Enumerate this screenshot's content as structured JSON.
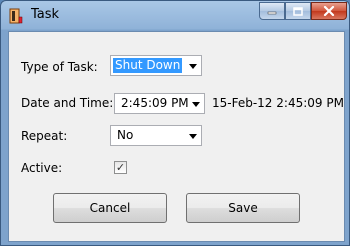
{
  "window": {
    "title": "Task",
    "controls": {
      "minimize": "minimize",
      "maximize": "maximize",
      "close": "close"
    },
    "icon": "task-app-icon"
  },
  "form": {
    "type_label": "Type of Task:",
    "type_value": "Shut Down",
    "date_label": "Date and Time:",
    "time_value": "2:45:09 PM",
    "datetime_display": "15-Feb-12 2:45:09 PM",
    "repeat_label": "Repeat:",
    "repeat_value": "No",
    "active_label": "Active:",
    "active_checked": true,
    "active_mark": "✓"
  },
  "buttons": {
    "cancel": "Cancel",
    "save": "Save"
  },
  "colors": {
    "titlebar": "#8fb2d8",
    "selection": "#3399ff",
    "close": "#c2381c"
  }
}
